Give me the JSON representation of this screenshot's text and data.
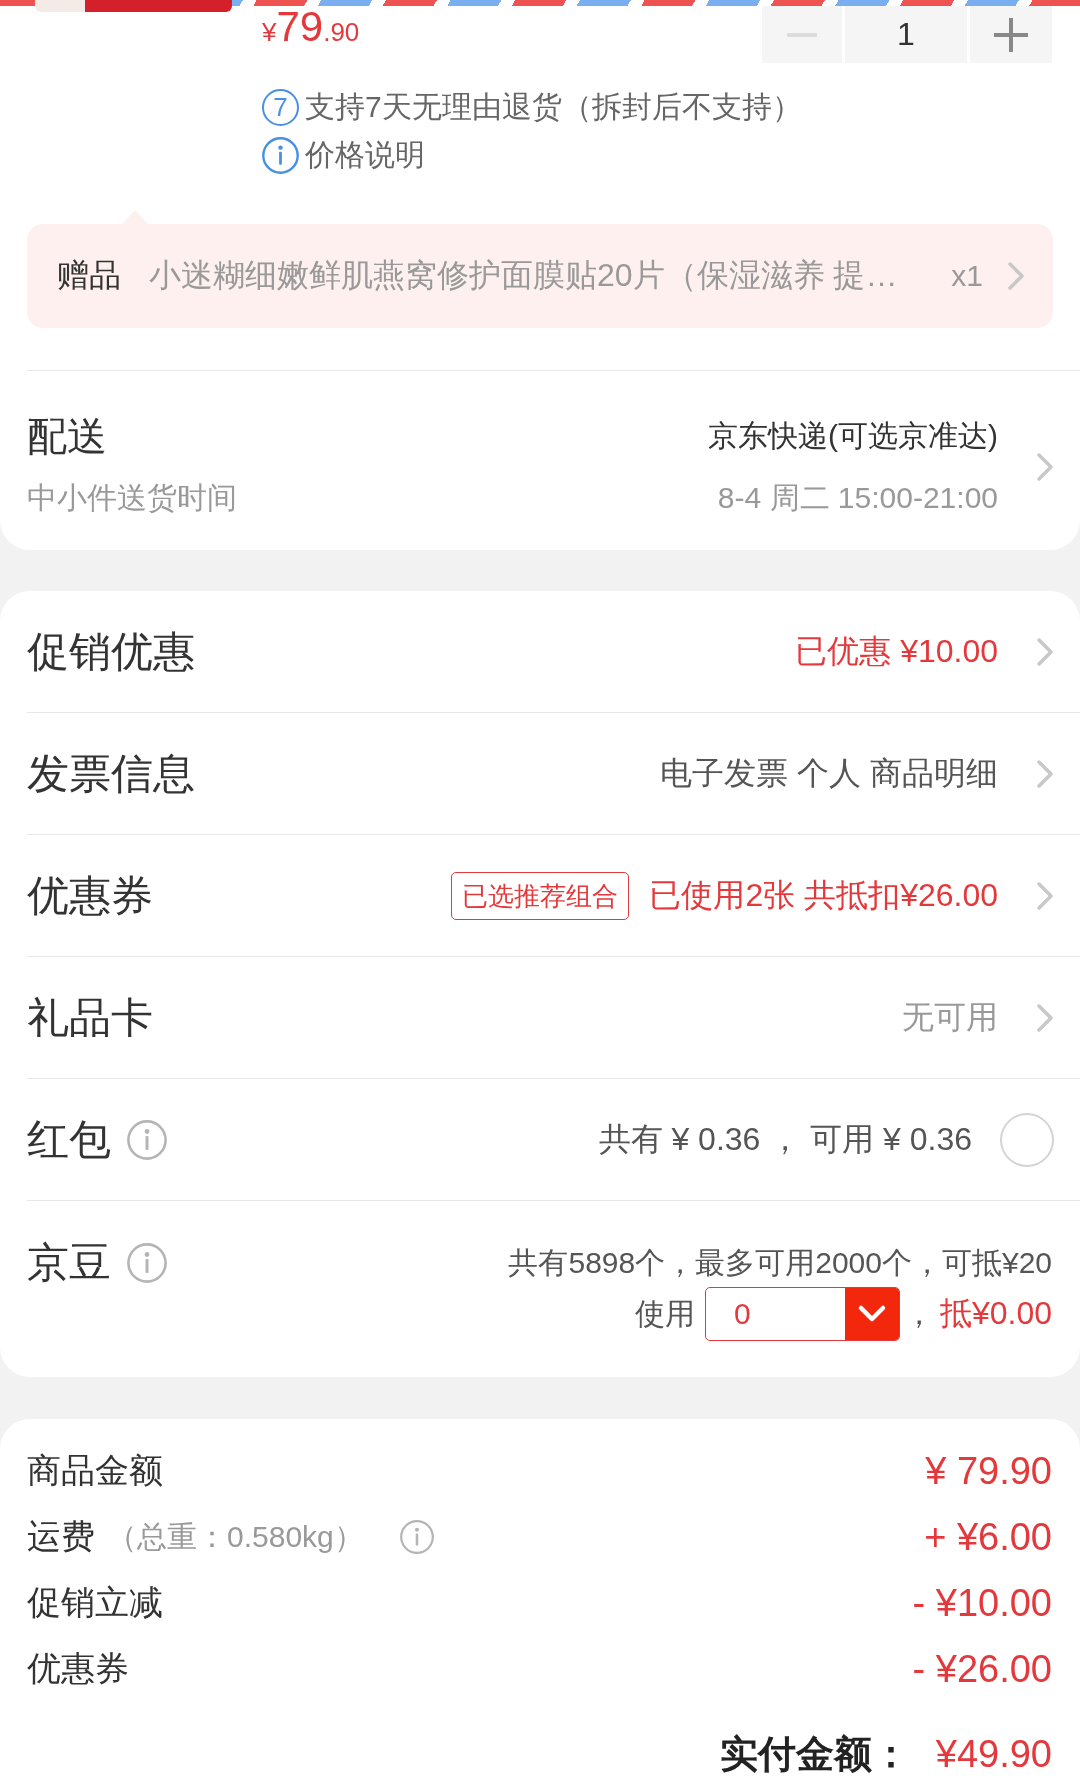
{
  "product": {
    "price": {
      "currency": "¥",
      "integer": "79",
      "fraction": ".90"
    },
    "quantity": {
      "value": "1",
      "decrease_disabled": true
    },
    "services": [
      {
        "kind": "days",
        "badge": "7",
        "text": "支持7天无理由退货（拆封后不支持）"
      },
      {
        "kind": "info",
        "text": "价格说明"
      }
    ]
  },
  "gift": {
    "label": "赠品",
    "name": "小迷糊细嫩鲜肌燕窝修护面膜贴20片（保湿滋养 提…",
    "count": "x1"
  },
  "delivery": {
    "title": "配送",
    "subtitle": "中小件送货时间",
    "method": "京东快递(可选京准达)",
    "time": "8-4 周二 15:00-21:00"
  },
  "options": [
    {
      "kind": "link",
      "label": "促销优惠",
      "value": "已优惠 ¥10.00",
      "color": "#e4393c"
    },
    {
      "kind": "link",
      "label": "发票信息",
      "value": "电子发票 个人 商品明细",
      "color": "#555555"
    },
    {
      "kind": "link",
      "label": "优惠券",
      "tag": "已选推荐组合",
      "value": "已使用2张 共抵扣¥26.00",
      "color": "#e4393c"
    },
    {
      "kind": "link",
      "label": "礼品卡",
      "value": "无可用",
      "color": "#999999"
    },
    {
      "kind": "toggle",
      "label": "红包",
      "info": true,
      "value": "共有 ¥ 0.36 ， 可用 ¥ 0.36",
      "color": "#555555",
      "checked": false
    },
    {
      "kind": "beans",
      "label": "京豆",
      "info": true,
      "value": "共有5898个，最多可用2000个，可抵¥20",
      "color": "#555555",
      "use_label": "使用",
      "input_value": "0",
      "separator": "，",
      "deduction": "抵¥0.00"
    }
  ],
  "summary": {
    "lines": [
      {
        "label": "商品金额",
        "amount": "¥ 79.90"
      },
      {
        "label": "运费",
        "note": "（总重：0.580kg）",
        "info": true,
        "amount": "+ ¥6.00"
      },
      {
        "label": "促销立减",
        "amount": "- ¥10.00"
      },
      {
        "label": "优惠券",
        "amount": "- ¥26.00"
      }
    ],
    "total": {
      "label": "实付金额：",
      "amount": "¥49.90"
    }
  }
}
